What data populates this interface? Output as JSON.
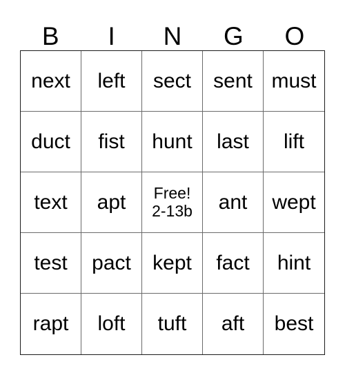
{
  "card": {
    "type": "bingo-card",
    "columns": 5,
    "rows": 5,
    "header": [
      "B",
      "I",
      "N",
      "G",
      "O"
    ],
    "grid": [
      [
        "next",
        "left",
        "sect",
        "sent",
        "must"
      ],
      [
        "duct",
        "fist",
        "hunt",
        "last",
        "lift"
      ],
      [
        "text",
        "apt",
        "FREE",
        "ant",
        "wept"
      ],
      [
        "test",
        "pact",
        "kept",
        "fact",
        "hint"
      ],
      [
        "rapt",
        "loft",
        "tuft",
        "aft",
        "best"
      ]
    ],
    "free_space": {
      "row": 3,
      "column": 3,
      "line1": "Free!",
      "line2": "2-13b"
    },
    "colors": {
      "background": "#ffffff",
      "text": "#000000",
      "outer_border": "#1a1a1a",
      "inner_border": "#6a6a6a"
    }
  }
}
